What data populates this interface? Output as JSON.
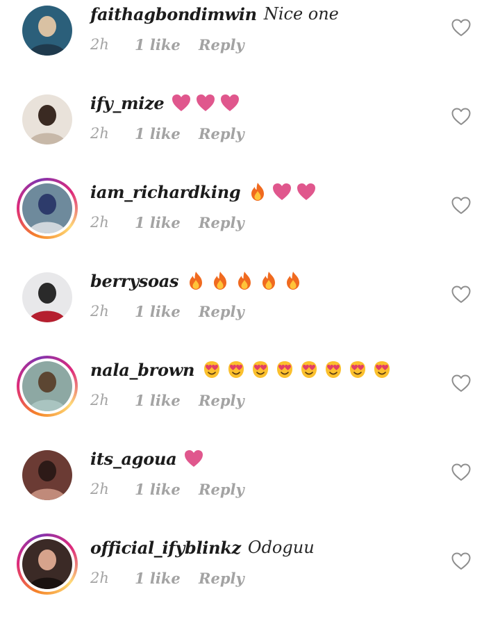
{
  "comments": [
    {
      "username": "faithagbondimwin",
      "text": "Nice one",
      "emojis": [],
      "time": "2h",
      "likes": "1 like",
      "reply": "Reply",
      "story": false
    },
    {
      "username": "ify_mize",
      "text": "",
      "emojis": [
        "heart",
        "heart",
        "heart"
      ],
      "time": "2h",
      "likes": "1 like",
      "reply": "Reply",
      "story": false
    },
    {
      "username": "iam_richardking",
      "text": "",
      "emojis": [
        "fire",
        "heart",
        "heart"
      ],
      "time": "2h",
      "likes": "1 like",
      "reply": "Reply",
      "story": true
    },
    {
      "username": "berrysoas",
      "text": "",
      "emojis": [
        "fire",
        "fire",
        "fire",
        "fire",
        "fire"
      ],
      "time": "2h",
      "likes": "1 like",
      "reply": "Reply",
      "story": false
    },
    {
      "username": "nala_brown",
      "text": "",
      "emojis": [
        "heart-eyes",
        "heart-eyes",
        "heart-eyes",
        "heart-eyes",
        "heart-eyes",
        "heart-eyes",
        "heart-eyes",
        "heart-eyes"
      ],
      "time": "2h",
      "likes": "1 like",
      "reply": "Reply",
      "story": true
    },
    {
      "username": "its_agoua",
      "text": "",
      "emojis": [
        "heart"
      ],
      "time": "2h",
      "likes": "1 like",
      "reply": "Reply",
      "story": false
    },
    {
      "username": "official_ifyblinkz",
      "text": "Odoguu",
      "emojis": [],
      "time": "2h",
      "likes": "1 like",
      "reply": "Reply",
      "story": true
    }
  ],
  "colors": {
    "username": "#1c1c1c",
    "meta": "#a3a3a3",
    "heart_emoji": "#e0578d",
    "fire_emoji": "#f06a1f",
    "heart_eyes_face": "#fbc02d",
    "like_icon_stroke": "#8e8e8e"
  },
  "icons": {
    "like": "heart-outline-icon",
    "avatar": "avatar",
    "story_ring": "story-ring"
  }
}
